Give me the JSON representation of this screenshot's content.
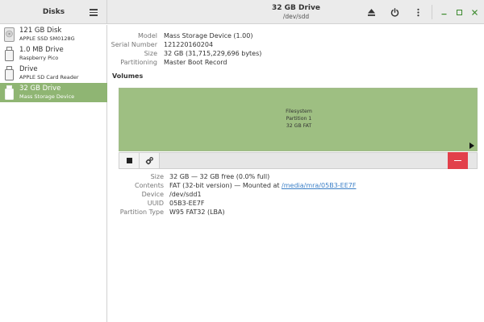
{
  "sidebar_header": {
    "title": "Disks"
  },
  "header": {
    "title": "32 GB Drive",
    "subtitle": "/dev/sdd"
  },
  "drives": [
    {
      "name": "121 GB Disk",
      "sub": "APPLE SSD SM0128G",
      "icon": "disk-icon"
    },
    {
      "name": "1.0 MB Drive",
      "sub": "Raspberry Pico",
      "icon": "usb-drive-icon"
    },
    {
      "name": "Drive",
      "sub": "APPLE SD Card Reader",
      "icon": "usb-drive-icon"
    },
    {
      "name": "32 GB Drive",
      "sub": "Mass Storage Device",
      "icon": "usb-drive-icon",
      "selected": true
    }
  ],
  "drive_info": {
    "model_label": "Model",
    "model": "Mass Storage Device (1.00)",
    "serial_label": "Serial Number",
    "serial": "121220160204",
    "size_label": "Size",
    "size": "32 GB (31,715,229,696 bytes)",
    "partitioning_label": "Partitioning",
    "partitioning": "Master Boot Record"
  },
  "volumes": {
    "title": "Volumes",
    "map": {
      "line1": "Filesystem",
      "line2": "Partition 1",
      "line3": "32 GB FAT"
    }
  },
  "partition_info": {
    "size_label": "Size",
    "size": "32 GB — 32 GB free (0.0% full)",
    "contents_label": "Contents",
    "contents_prefix": "FAT (32-bit version) — Mounted at ",
    "mount_path": "/media/mra/05B3-EE7F",
    "device_label": "Device",
    "device": "/dev/sdd1",
    "uuid_label": "UUID",
    "uuid": "05B3-EE7F",
    "ptype_label": "Partition Type",
    "ptype": "W95 FAT32 (LBA)"
  },
  "colors": {
    "selection": "#8fb573",
    "volume_fill": "#9ebf82",
    "delete_button": "#e2404a",
    "link": "#3b7fc7"
  }
}
